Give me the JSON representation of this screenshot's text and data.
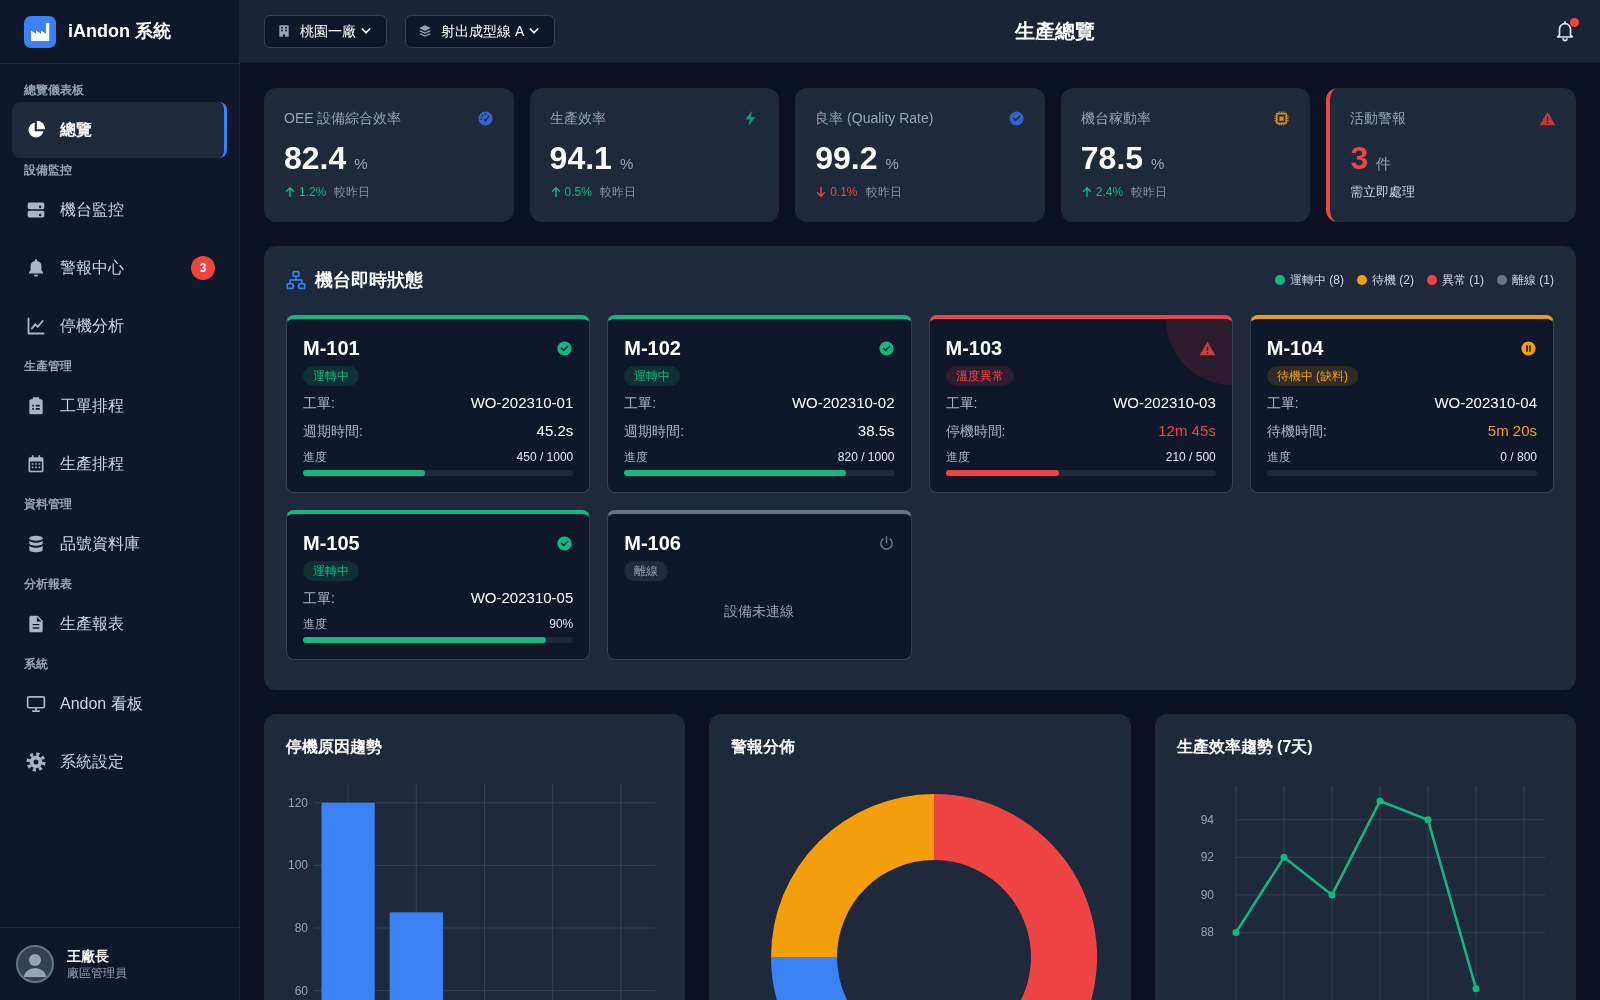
{
  "sidebar": {
    "brand": "iAndon 系統",
    "sections": [
      {
        "title": "總覽儀表板",
        "items": [
          {
            "label": "總覽",
            "selected": true
          }
        ]
      },
      {
        "title": "設備監控",
        "items": [
          {
            "label": "機台監控",
            "selected": false
          },
          {
            "label": "警報中心",
            "selected": false,
            "badge": "3"
          },
          {
            "label": "停機分析",
            "selected": false
          }
        ]
      },
      {
        "title": "生產管理",
        "items": [
          {
            "label": "工單排程",
            "selected": false
          },
          {
            "label": "生產排程",
            "selected": false
          }
        ]
      },
      {
        "title": "資料管理",
        "items": [
          {
            "label": "品號資料庫",
            "selected": false
          }
        ]
      },
      {
        "title": "分析報表",
        "items": [
          {
            "label": "生產報表",
            "selected": false
          }
        ]
      },
      {
        "title": "系統",
        "items": [
          {
            "label": "Andon 看板",
            "selected": false
          },
          {
            "label": "系統設定",
            "selected": false
          }
        ]
      }
    ],
    "user": {
      "name": "王廠長",
      "role": "廠區管理員"
    }
  },
  "header": {
    "selectors": [
      "桃園一廠",
      "射出成型線 A"
    ],
    "title": "生產總覽",
    "notifications": {
      "unread": true
    }
  },
  "kpis": [
    {
      "kind": "metric",
      "label": "OEE 設備綜合效率",
      "value": "82.4",
      "unit": "%",
      "rising": true,
      "change": "1.2%",
      "note": "較昨日"
    },
    {
      "kind": "metric",
      "label": "生產效率",
      "value": "94.1",
      "unit": "%",
      "rising": true,
      "change": "0.5%",
      "note": "較昨日"
    },
    {
      "kind": "metric",
      "label": "良率 (Quality Rate)",
      "value": "99.2",
      "unit": "%",
      "rising": false,
      "change": "0.1%",
      "note": "較昨日"
    },
    {
      "kind": "metric",
      "label": "機台稼動率",
      "value": "78.5",
      "unit": "%",
      "rising": true,
      "change": "2.4%",
      "note": "較昨日"
    },
    {
      "kind": "alert",
      "label": "活動警報",
      "value": "3",
      "unit": "件",
      "note": "需立即處理"
    }
  ],
  "machine_panel": {
    "title": "機台即時狀態",
    "legend": [
      {
        "label": "運轉中 (8)",
        "color": "#10b981"
      },
      {
        "label": "待機 (2)",
        "color": "#f59e0b"
      },
      {
        "label": "異常 (1)",
        "color": "#ef4444"
      },
      {
        "label": "離線 (1)",
        "color": "#64748b"
      }
    ],
    "machines": [
      {
        "id": "M-101",
        "kind": "running",
        "badge": "運轉中",
        "fields": [
          {
            "label": "工單:",
            "value": "WO-202310-01",
            "highlight": false
          },
          {
            "label": "週期時間:",
            "value": "45.2s",
            "highlight": false
          }
        ],
        "progress": {
          "label": "進度",
          "reading": "450 / 1000",
          "level": 0.45
        }
      },
      {
        "id": "M-102",
        "kind": "running",
        "badge": "運轉中",
        "fields": [
          {
            "label": "工單:",
            "value": "WO-202310-02",
            "highlight": false
          },
          {
            "label": "週期時間:",
            "value": "38.5s",
            "highlight": false
          }
        ],
        "progress": {
          "label": "進度",
          "reading": "820 / 1000",
          "level": 0.82
        }
      },
      {
        "id": "M-103",
        "kind": "alarm",
        "badge": "溫度異常",
        "fields": [
          {
            "label": "工單:",
            "value": "WO-202310-03",
            "highlight": false
          },
          {
            "label": "停機時間:",
            "value": "12m 45s",
            "highlight": true
          }
        ],
        "progress": {
          "label": "進度",
          "reading": "210 / 500",
          "level": 0.42
        }
      },
      {
        "id": "M-104",
        "kind": "idle",
        "badge": "待機中 (缺料)",
        "fields": [
          {
            "label": "工單:",
            "value": "WO-202310-04",
            "highlight": false
          },
          {
            "label": "待機時間:",
            "value": "5m 20s",
            "highlight": true
          }
        ],
        "progress": {
          "label": "進度",
          "reading": "0 / 800",
          "level": 0
        }
      },
      {
        "id": "M-105",
        "kind": "running",
        "badge": "運轉中",
        "fields": [
          {
            "label": "工單:",
            "value": "WO-202310-05",
            "highlight": false
          }
        ],
        "progress": {
          "label": "進度",
          "reading": "90%",
          "level": 0.9
        }
      },
      {
        "id": "M-106",
        "kind": "offline",
        "badge": "離線",
        "message": "設備未連線"
      }
    ]
  },
  "charts": [
    {
      "title": "停機原因趨勢",
      "chart_data": {
        "type": "bar",
        "values": [
          120,
          85,
          null,
          null,
          null
        ],
        "ylim": [
          57,
          126
        ],
        "yticks": [
          60,
          80,
          100,
          120
        ],
        "grid": true
      }
    },
    {
      "title": "警報分佈"
    },
    {
      "title": "生產效率趨勢 (7天)",
      "chart_data": {
        "type": "line",
        "values": [
          88,
          92,
          90,
          95,
          94,
          85,
          null
        ],
        "ylim": [
          84.4,
          95.8
        ],
        "yticks": [
          88,
          90,
          92,
          94
        ],
        "grid": true,
        "marker": true
      }
    }
  ]
}
